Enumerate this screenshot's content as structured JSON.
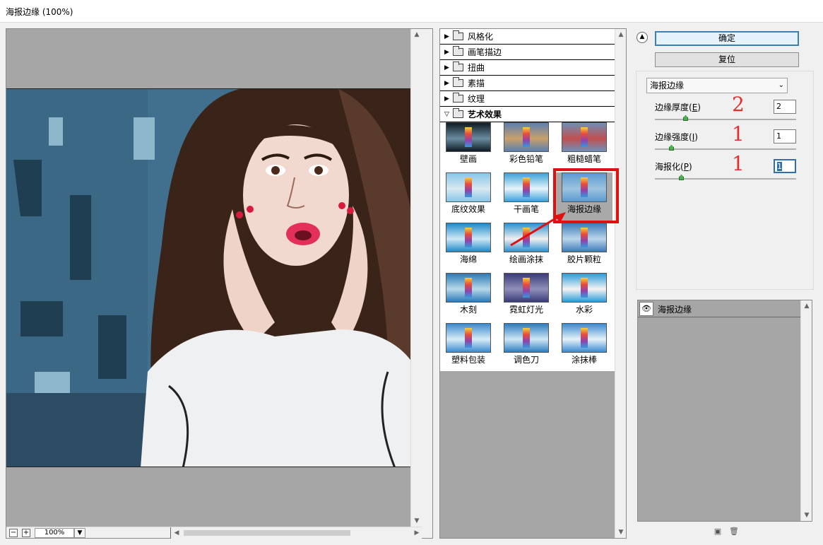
{
  "window": {
    "title": "海报边缘 (100%)"
  },
  "preview": {
    "zoom": "100%",
    "zoom_out": "−",
    "zoom_in": "+"
  },
  "filter_categories": [
    {
      "label": "风格化",
      "expanded": false
    },
    {
      "label": "画笔描边",
      "expanded": false
    },
    {
      "label": "扭曲",
      "expanded": false
    },
    {
      "label": "素描",
      "expanded": false
    },
    {
      "label": "纹理",
      "expanded": false
    },
    {
      "label": "艺术效果",
      "expanded": true
    }
  ],
  "art_filters": [
    {
      "label": "壁画"
    },
    {
      "label": "彩色铅笔"
    },
    {
      "label": "粗糙蜡笔"
    },
    {
      "label": "底纹效果"
    },
    {
      "label": "干画笔"
    },
    {
      "label": "海报边缘",
      "selected": true
    },
    {
      "label": "海绵"
    },
    {
      "label": "绘画涂抹"
    },
    {
      "label": "胶片颗粒"
    },
    {
      "label": "木刻"
    },
    {
      "label": "霓虹灯光"
    },
    {
      "label": "水彩"
    },
    {
      "label": "塑料包装"
    },
    {
      "label": "调色刀"
    },
    {
      "label": "涂抹棒"
    }
  ],
  "buttons": {
    "ok": "确定",
    "reset": "复位"
  },
  "filter_select": {
    "value": "海报边缘"
  },
  "params": [
    {
      "label": "边缘厚度(",
      "key": "E",
      "value": "2",
      "annotation": "2",
      "level": 0.2
    },
    {
      "label": "边缘强度(",
      "key": "I",
      "value": "1",
      "annotation": "1",
      "level": 0.1
    },
    {
      "label": "海报化(",
      "key": "P",
      "value": "1",
      "annotation": "1",
      "level": 0.17
    }
  ],
  "layers": {
    "items": [
      {
        "label": "海报边缘"
      }
    ]
  },
  "colors": {
    "highlight": "#e01010",
    "annotation": "#e03030",
    "primary_border": "#3c7fb1"
  }
}
